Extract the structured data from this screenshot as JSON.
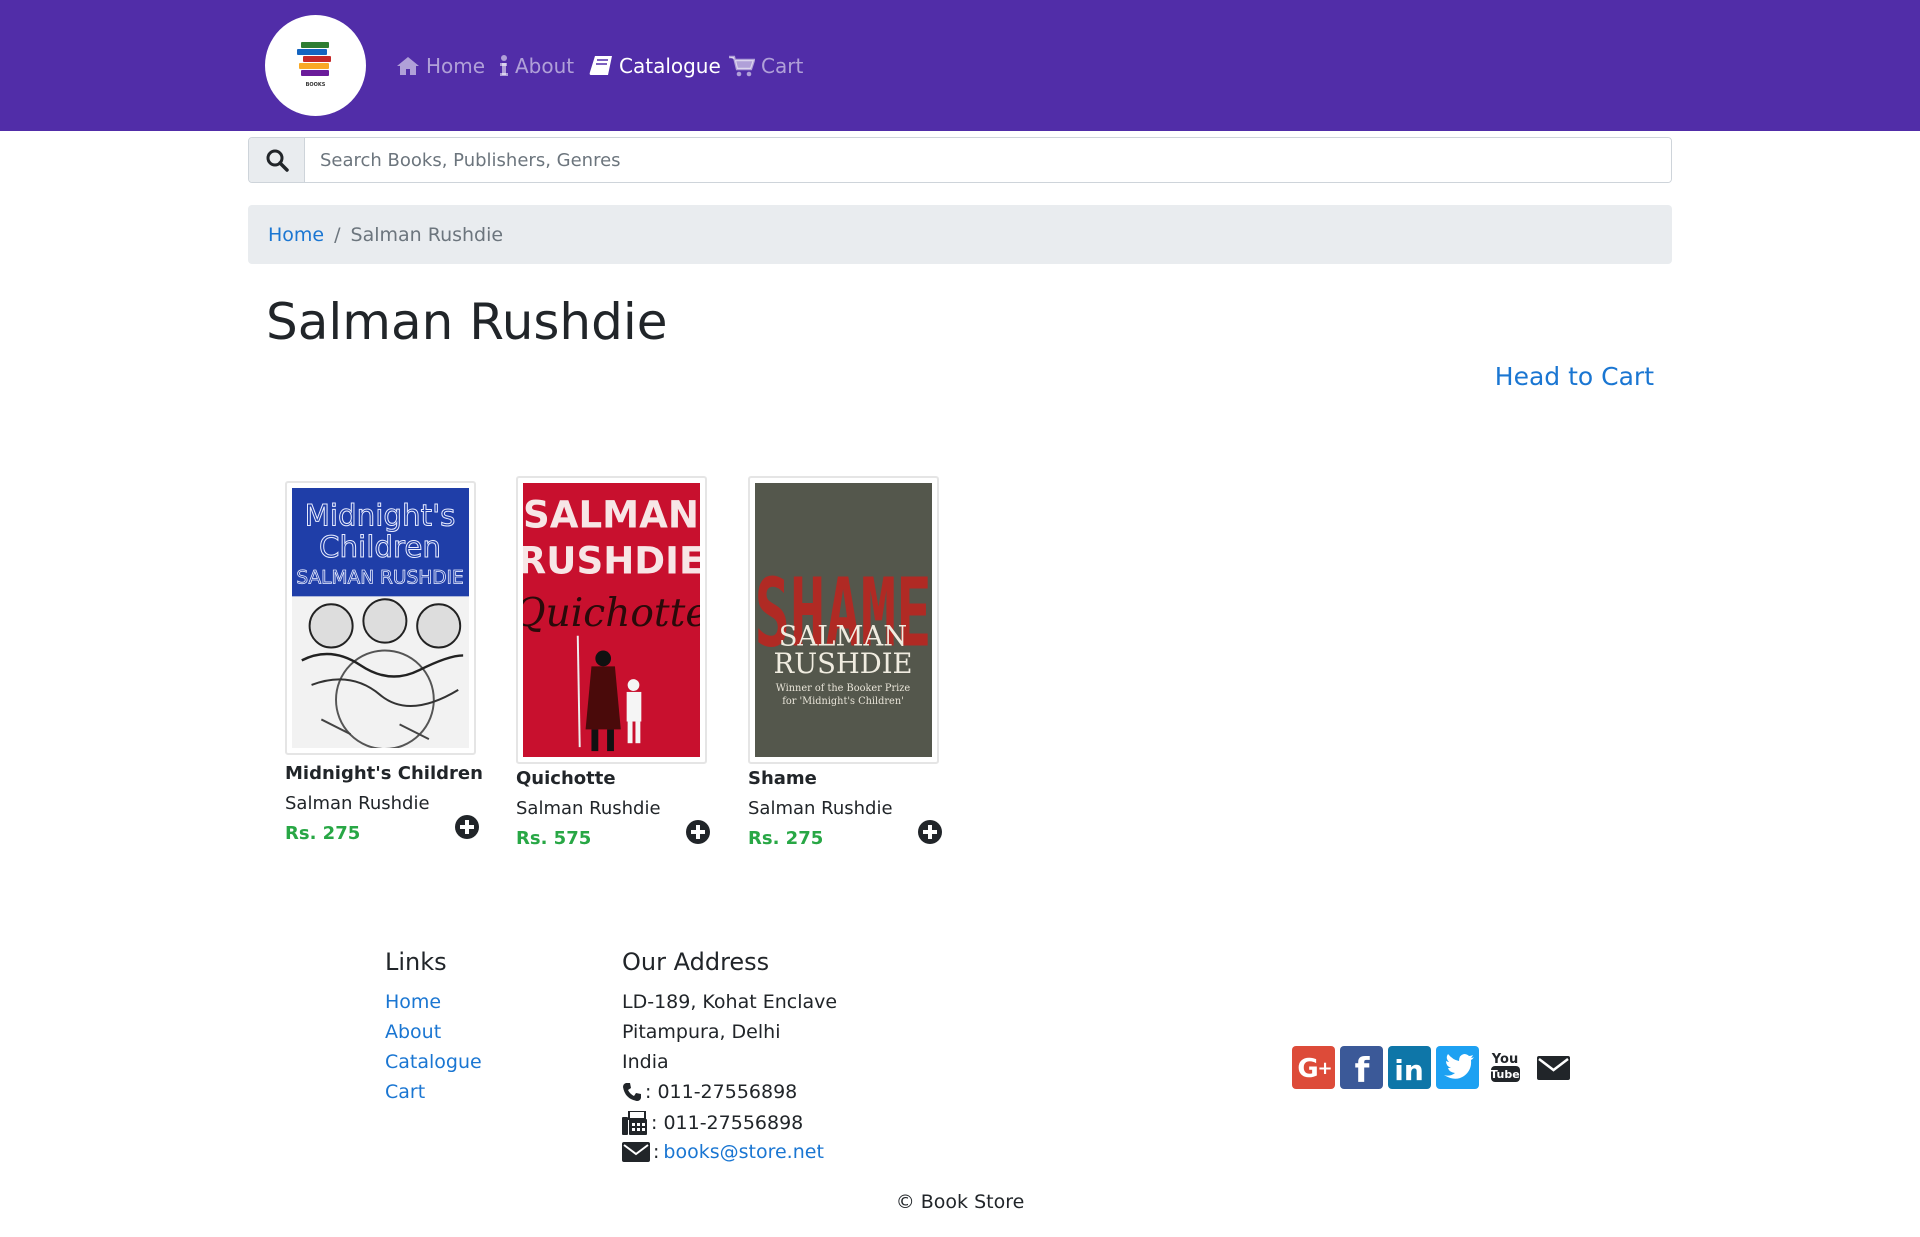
{
  "nav": {
    "logo_text": "BOOKS",
    "items": [
      {
        "label": "Home",
        "icon": "home-icon"
      },
      {
        "label": "About",
        "icon": "info-icon"
      },
      {
        "label": "Catalogue",
        "icon": "book-icon"
      },
      {
        "label": "Cart",
        "icon": "cart-icon"
      }
    ],
    "active": "Catalogue"
  },
  "search": {
    "placeholder": "Search Books, Publishers, Genres",
    "value": ""
  },
  "breadcrumb": {
    "home": "Home",
    "separator": "/",
    "current": "Salman Rushdie"
  },
  "page": {
    "title": "Salman Rushdie",
    "cart_link": "Head to Cart"
  },
  "books": [
    {
      "title": "Midnight's Children",
      "author": "Salman Rushdie",
      "price": "Rs. 275",
      "cover_text": [
        "Midnight's",
        "Children",
        "SALMAN RUSHDIE"
      ],
      "cover_color": "#1f3ea8"
    },
    {
      "title": "Quichotte",
      "author": "Salman Rushdie",
      "price": "Rs. 575",
      "cover_text": [
        "SALMAN",
        "RUSHDIE",
        "Quichotte"
      ],
      "cover_color": "#c8102e"
    },
    {
      "title": "Shame",
      "author": "Salman Rushdie",
      "price": "Rs. 275",
      "cover_text": [
        "SHAME",
        "SALMAN",
        "RUSHDIE",
        "Winner of the Booker Prize",
        "for 'Midnight's Children'"
      ],
      "cover_color": "#54574c"
    }
  ],
  "footer": {
    "links_heading": "Links",
    "links": [
      "Home",
      "About",
      "Catalogue",
      "Cart"
    ],
    "address_heading": "Our Address",
    "address": [
      "LD-189, Kohat Enclave",
      "Pitampura, Delhi",
      "India"
    ],
    "phone": ": 011-27556898",
    "fax": ": 011-27556898",
    "email_prefix": ":",
    "email": "books@store.net",
    "social": [
      "google-plus-icon",
      "facebook-icon",
      "linkedin-icon",
      "twitter-icon",
      "youtube-icon",
      "envelope-icon"
    ],
    "copyright": "© Book Store"
  },
  "colors": {
    "brand": "#512DA8",
    "link": "#1a76d2",
    "price": "#28a745"
  }
}
